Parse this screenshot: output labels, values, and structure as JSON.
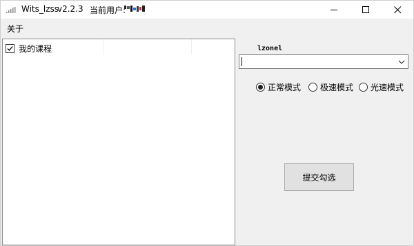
{
  "titlebar": {
    "app_name": "Wits_lzss",
    "version": "v2.2.3",
    "user_label": "当前用户:",
    "window_controls": [
      "minimize-icon",
      "maximize-icon",
      "close-icon"
    ]
  },
  "menu": {
    "items": [
      {
        "label": "关于"
      }
    ]
  },
  "course_tree": {
    "items": [
      {
        "label": "我的课程",
        "checked": true
      }
    ]
  },
  "account_select": {
    "label": "lzonel",
    "value": ""
  },
  "modes": [
    {
      "label": "正常模式",
      "selected": true
    },
    {
      "label": "极速模式",
      "selected": false
    },
    {
      "label": "光速模式",
      "selected": false
    }
  ],
  "submit_label": "提交勾选",
  "colors": {
    "window_bg": "#f0f0f0",
    "titlebar_bg": "#ffffff",
    "button_bg": "#e1e1e1"
  }
}
